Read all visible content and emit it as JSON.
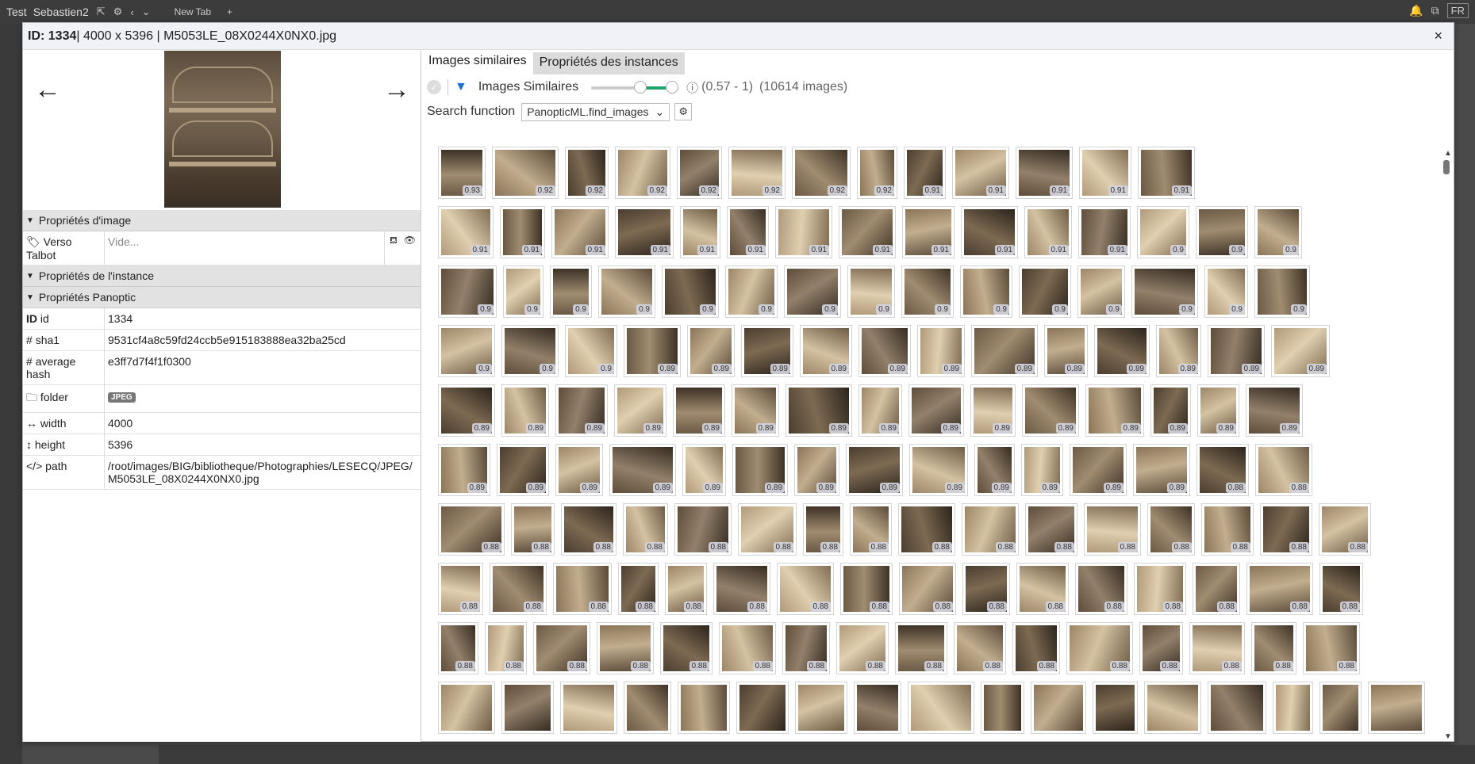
{
  "app": {
    "user_title": "Test",
    "project": "Sebastien2",
    "new_tab": "New Tab",
    "plus": "+",
    "lang": "FR"
  },
  "header": {
    "id_label": "ID: 1334",
    "dims": " | 4000 x 5396 | M5053LE_08X0244X0NX0.jpg",
    "close": "×"
  },
  "nav": {
    "prev": "←",
    "next": "→"
  },
  "sections": {
    "image_props": "Propriétés d'image",
    "instance_props": "Propriétés de l'instance",
    "panoptic_props": "Propriétés Panoptic"
  },
  "image_props": [
    {
      "key": "Verso Talbot",
      "value": "Vide..."
    }
  ],
  "panoptic_props": [
    {
      "icon": "ID",
      "key": "id",
      "value": "1334"
    },
    {
      "icon": "#",
      "key": "sha1",
      "value": "9531cf4a8c59fd24ccb5e915183888ea32ba25cd"
    },
    {
      "icon": "#",
      "key": "average hash",
      "value": "e3ff7d7f4f1f0300"
    },
    {
      "icon": "🗀",
      "key": "folder",
      "value": "JPEG"
    },
    {
      "icon": "↔",
      "key": "width",
      "value": "4000"
    },
    {
      "icon": "↕",
      "key": "height",
      "value": "5396"
    },
    {
      "icon": "</>",
      "key": "path",
      "value": "/root/images/BIG/bibliotheque/Photographies/LESECQ/JPEG/M5053LE_08X0244X0NX0.jpg"
    }
  ],
  "tabs": [
    {
      "label": "Images similaires",
      "active": true
    },
    {
      "label": "Propriétés des instances",
      "active": false
    }
  ],
  "toolbar": {
    "title": "Images Similaires",
    "slider_min": 0.57,
    "slider_max": 1,
    "range_text": "(0.57 - 1)",
    "count_text": "(10614 images)"
  },
  "search": {
    "label": "Search function",
    "selected": "PanopticML.find_images"
  },
  "rows": [
    [
      "0.93",
      "0.92",
      "0.92",
      "0.92",
      "0.92",
      "0.92",
      "0.92",
      "0.92",
      "0.91",
      "0.91",
      "0.91",
      "0.91",
      "0.91"
    ],
    [
      "0.91",
      "0.91",
      "0.91",
      "0.91",
      "0.91",
      "0.91",
      "0.91",
      "0.91",
      "0.91",
      "0.91",
      "0.91",
      "0.91",
      "0.9",
      "0.9",
      "0.9"
    ],
    [
      "0.9",
      "0.9",
      "0.9",
      "0.9",
      "0.9",
      "0.9",
      "0.9",
      "0.9",
      "0.9",
      "0.9",
      "0.9",
      "0.9",
      "0.9",
      "0.9",
      "0.9"
    ],
    [
      "0.9",
      "0.9",
      "0.9",
      "0.89",
      "0.89",
      "0.89",
      "0.89",
      "0.89",
      "0.89",
      "0.89",
      "0.89",
      "0.89",
      "0.89",
      "0.89",
      "0.89"
    ],
    [
      "0.89",
      "0.89",
      "0.89",
      "0.89",
      "0.89",
      "0.89",
      "0.89",
      "0.89",
      "0.89",
      "0.89",
      "0.89",
      "0.89",
      "0.89",
      "0.89",
      "0.89"
    ],
    [
      "0.89",
      "0.89",
      "0.89",
      "0.89",
      "0.89",
      "0.89",
      "0.89",
      "0.89",
      "0.89",
      "0.89",
      "0.89",
      "0.89",
      "0.89",
      "0.88",
      "0.88"
    ],
    [
      "0.88",
      "0.88",
      "0.88",
      "0.88",
      "0.88",
      "0.88",
      "0.88",
      "0.88",
      "0.88",
      "0.88",
      "0.88",
      "0.88",
      "0.88",
      "0.88",
      "0.88",
      "0.88"
    ],
    [
      "0.88",
      "0.88",
      "0.88",
      "0.88",
      "0.88",
      "0.88",
      "0.88",
      "0.88",
      "0.88",
      "0.88",
      "0.88",
      "0.88",
      "0.88",
      "0.88",
      "0.88",
      "0.88"
    ],
    [
      "0.88",
      "0.88",
      "0.88",
      "0.88",
      "0.88",
      "0.88",
      "0.88",
      "0.88",
      "0.88",
      "0.88",
      "0.88",
      "0.88",
      "0.88",
      "0.88",
      "0.88",
      "0.88"
    ],
    [
      "",
      "",
      "",
      "",
      "",
      "",
      "",
      "",
      "",
      "",
      "",
      "",
      "",
      "",
      "",
      "",
      ""
    ]
  ],
  "colors": {
    "accent": "#22a56c",
    "filter": "#1e6fd9"
  }
}
